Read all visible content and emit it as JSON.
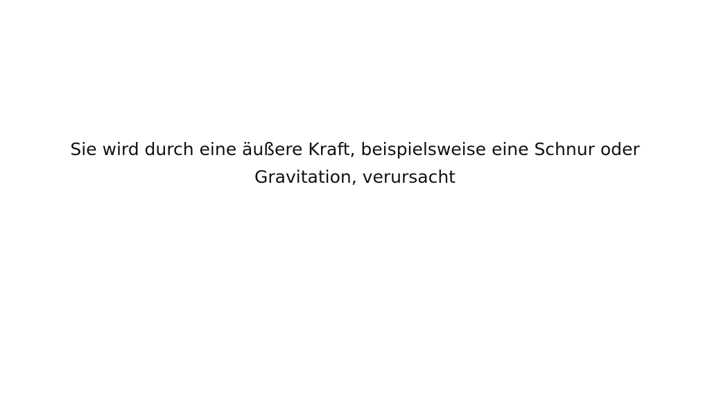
{
  "caption": {
    "line1": "Sie wird durch eine äußere Kraft, beispielsweise eine Schnur oder",
    "line2": "Gravitation, verursacht"
  },
  "colors": {
    "background": "#ffffff",
    "text": "#111111"
  }
}
